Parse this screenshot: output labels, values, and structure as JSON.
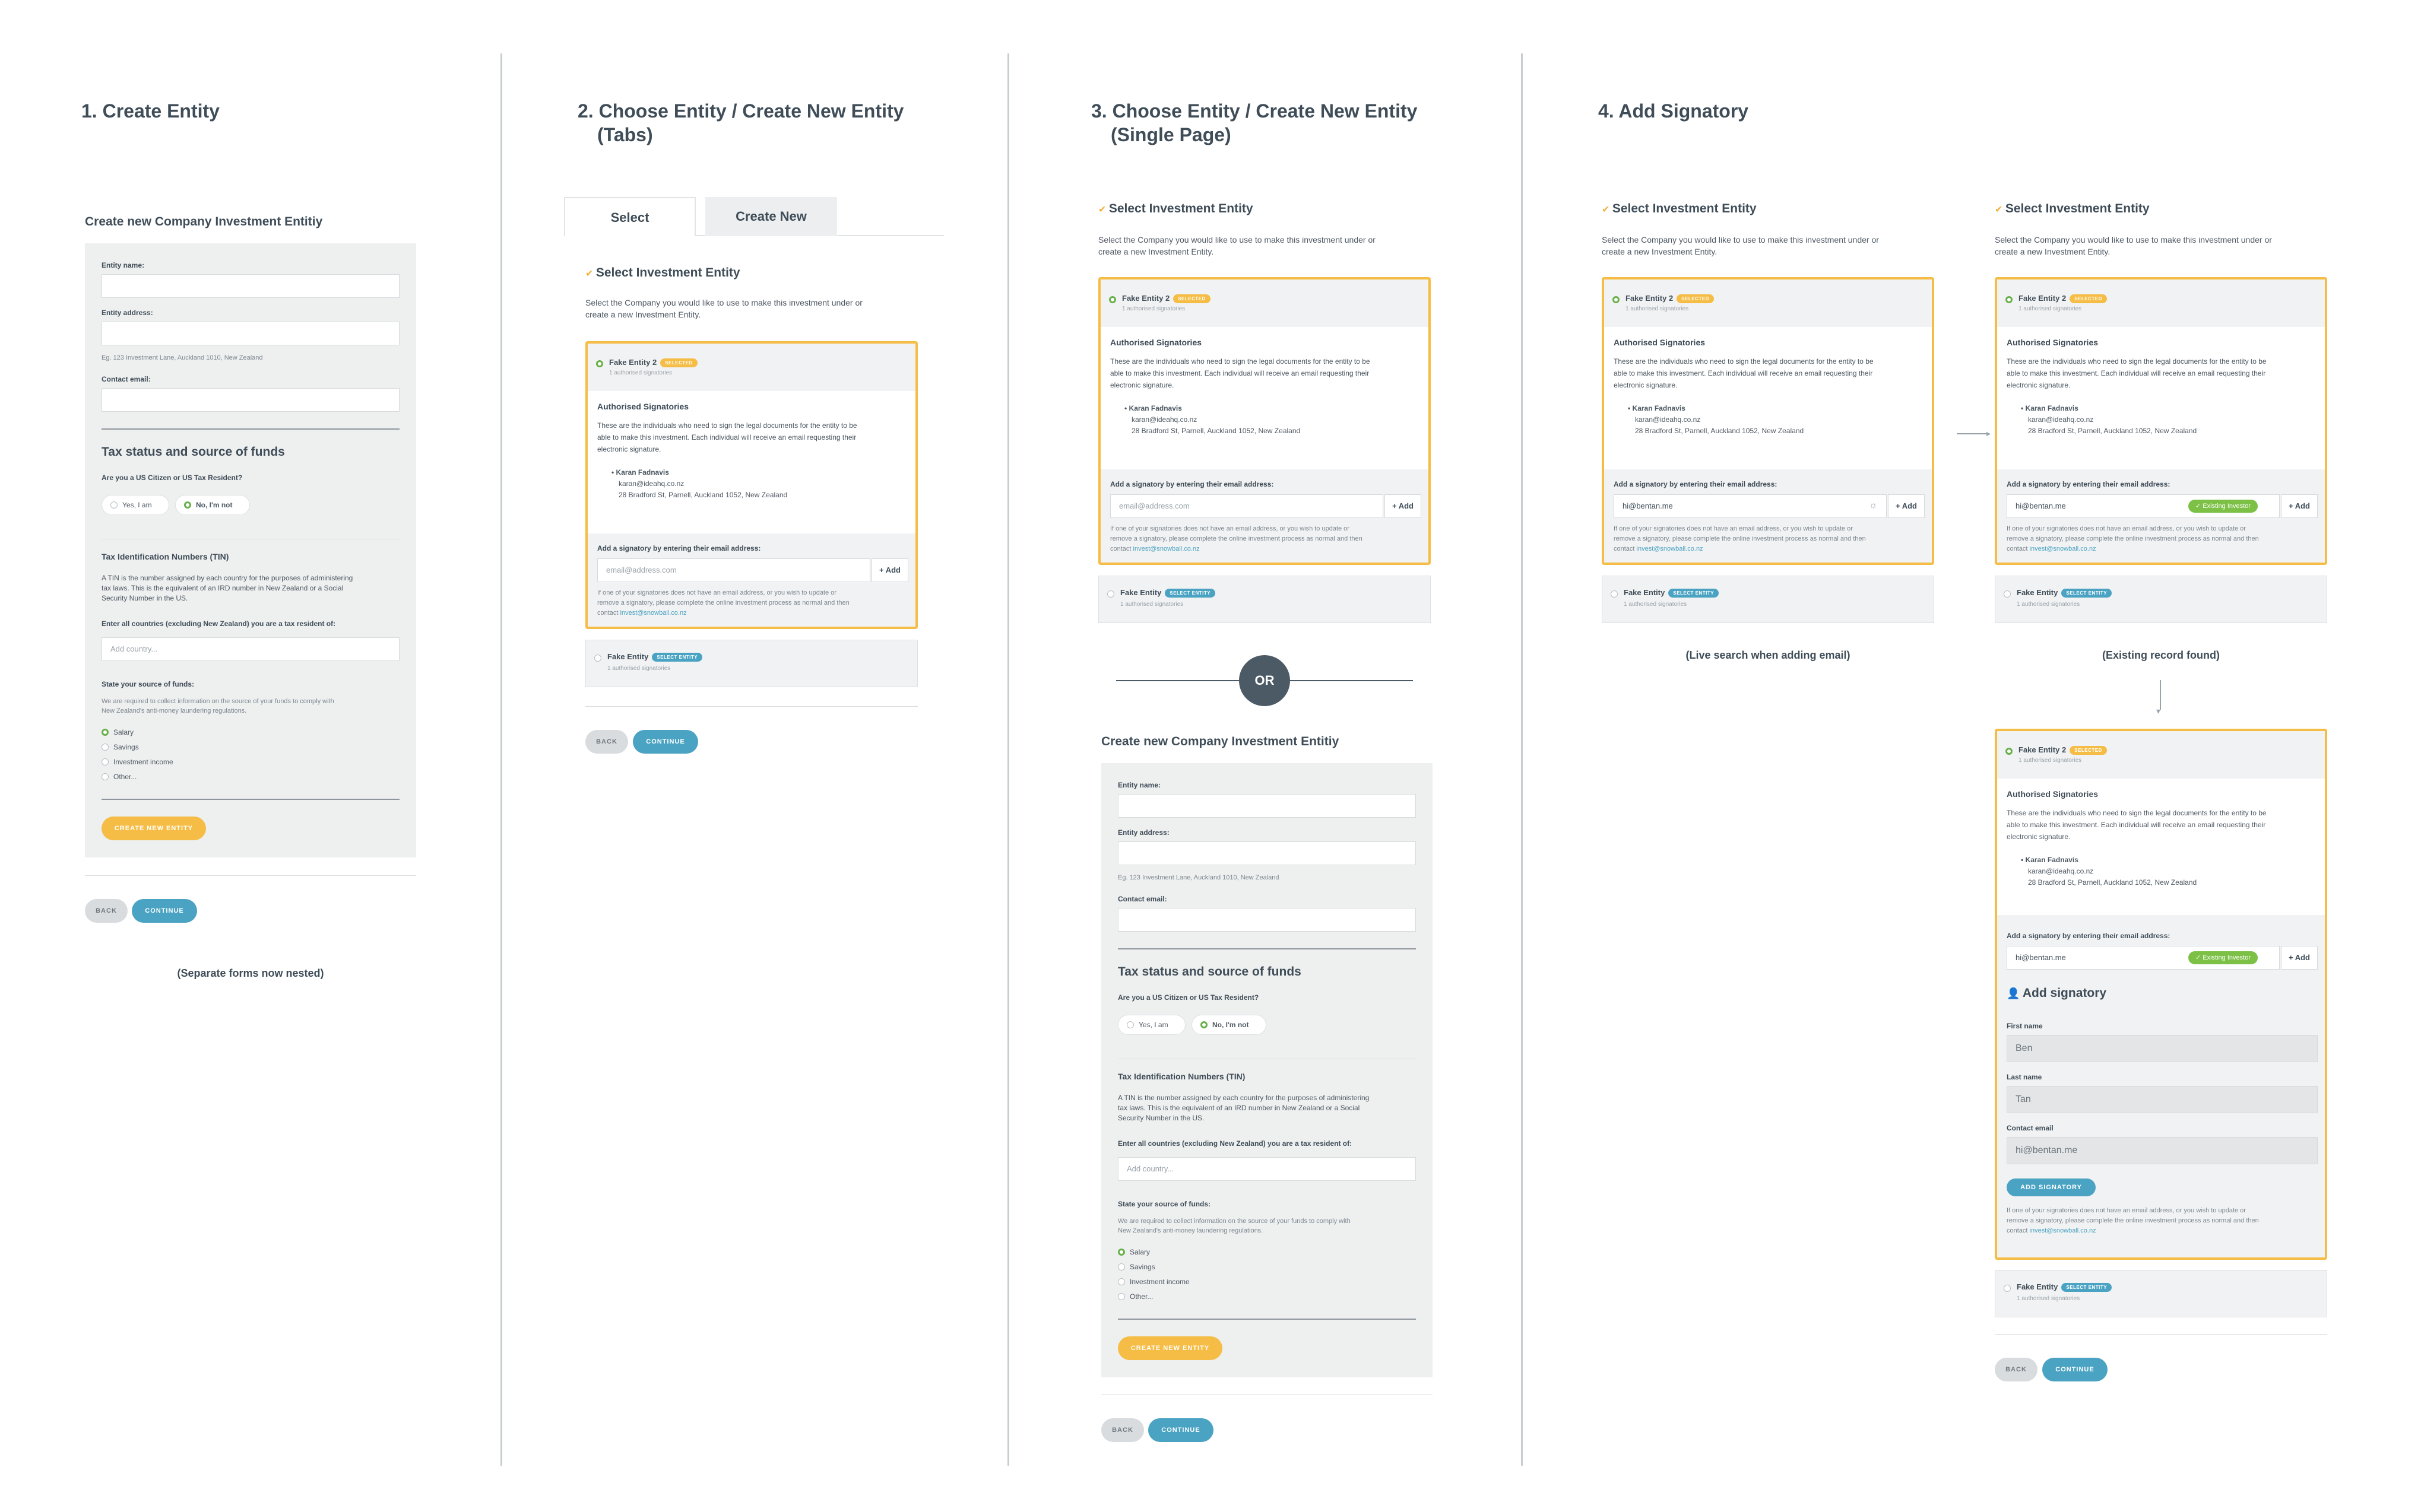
{
  "columns": {
    "col1": {
      "title": "1. Create Entity"
    },
    "col2": {
      "title_line1": "2. Choose Entity / Create New Entity",
      "title_line2": "(Tabs)"
    },
    "col3": {
      "title_line1": "3. Choose Entity / Create New Entity",
      "title_line2": "(Single Page)"
    },
    "col4": {
      "title": "4. Add Signatory"
    }
  },
  "create_form": {
    "heading": "Create new Company Investment Entitiy",
    "entity_name_label": "Entity name:",
    "entity_address_label": "Entity address:",
    "address_hint": "Eg. 123 Investment Lane, Auckland 1010, New Zealand",
    "contact_email_label": "Contact email:",
    "tax_heading": "Tax status and source of funds",
    "us_question": "Are you a US Citizen or US Tax Resident?",
    "yes_label": "Yes, I am",
    "no_label": "No, I'm not",
    "tin_heading": "Tax Identification Numbers (TIN)",
    "tin_text_1": "A TIN is the number assigned by each country for the purposes of administering",
    "tin_text_2": "tax laws. This is the equivalent of an IRD number in New Zealand or a Social",
    "tin_text_3": "Security Number in the US.",
    "countries_label": "Enter all countries (excluding New Zealand) you are a tax resident of:",
    "country_placeholder": "Add country...",
    "source_label": "State your source of funds:",
    "source_text_1": "We are required to collect information on the source of your funds to comply with",
    "source_text_2": "New Zealand's anti-money laundering regulations.",
    "funds": [
      "Salary",
      "Savings",
      "Investment income",
      "Other..."
    ],
    "create_button": "CREATE NEW ENTITY"
  },
  "nav": {
    "back": "BACK",
    "continue": "CONTINUE"
  },
  "captions": {
    "col1": "(Separate forms now nested)",
    "live": "(Live search when adding email)",
    "existing": "(Existing record found)"
  },
  "tabs": {
    "select": "Select",
    "create": "Create New"
  },
  "select_entity": {
    "heading": "Select Investment Entity",
    "intro_1": "Select the Company you would like to use to make this investment under or",
    "intro_2": "create a new Investment Entity.",
    "entity1_name": "Fake Entity 2",
    "selected_badge": "SELECTED",
    "signatories_count": "1 authorised signatories",
    "auth_heading": "Authorised Signatories",
    "auth_text_1": "These are the individuals who need to sign the legal documents for the entity to be",
    "auth_text_2": "able to make this investment. Each individual will receive an email requesting their",
    "auth_text_3": "electronic signature.",
    "sig_name": "Karan Fadnavis",
    "sig_email": "karan@ideahq.co.nz",
    "sig_address": "28 Bradford St, Parnell, Auckland 1052, New Zealand",
    "add_label": "Add a signatory by entering their email address:",
    "email_placeholder": "email@address.com",
    "add_button": "+ Add",
    "note_1": "If one of your signatories does not have an email address, or you wish to update or",
    "note_2": "remove a signatory, please complete the online investment process as normal and then",
    "note_3": "contact",
    "note_link": "invest@snowball.co.nz",
    "entity2_name": "Fake Entity",
    "select_badge": "SELECT ENTITY",
    "typed_email": "hi@bentan.me",
    "existing_badge": "✓ Existing Investor"
  },
  "or_label": "OR",
  "add_signatory": {
    "heading": "Add signatory",
    "first_name_label": "First name",
    "first_name": "Ben",
    "last_name_label": "Last name",
    "last_name": "Tan",
    "contact_email_label": "Contact email",
    "contact_email": "hi@bentan.me",
    "button": "ADD SIGNATORY"
  },
  "colors": {
    "accent_yellow": "#f5bd45",
    "accent_blue": "#4aa3c2",
    "success_green": "#7cc045",
    "dark": "#3f4d58"
  }
}
